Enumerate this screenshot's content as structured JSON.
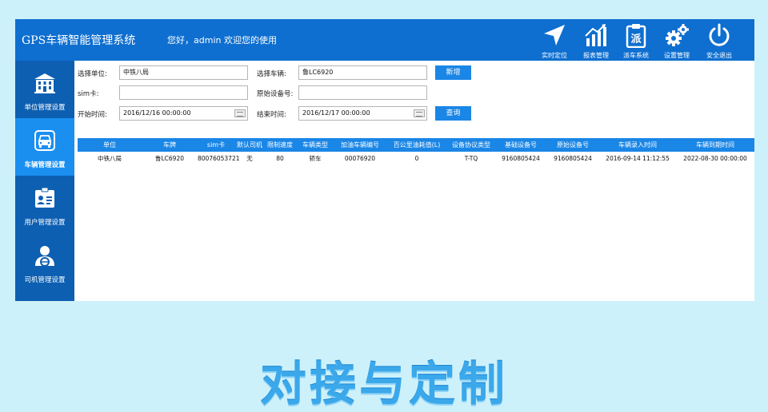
{
  "app": {
    "title": "GPS车辆智能管理系统",
    "welcome": "您好，admin 欢迎您的使用"
  },
  "topnav": [
    {
      "label": "实时定位",
      "icon": "navigation-arrow-icon"
    },
    {
      "label": "报表管理",
      "icon": "bar-chart-icon"
    },
    {
      "label": "派车系统",
      "icon": "dispatch-clipboard-icon",
      "glyph": "派"
    },
    {
      "label": "设置管理",
      "icon": "gears-icon"
    },
    {
      "label": "安全退出",
      "icon": "power-icon"
    }
  ],
  "sidebar": [
    {
      "label": "单位管理设置",
      "icon": "building-icon",
      "active": false
    },
    {
      "label": "车辆管理设置",
      "icon": "car-icon",
      "active": true
    },
    {
      "label": "用户管理设置",
      "icon": "id-card-icon",
      "active": false
    },
    {
      "label": "司机管理设置",
      "icon": "driver-icon",
      "active": false
    }
  ],
  "form": {
    "unit_label": "选择单位:",
    "unit_value": "中铁八局",
    "vehicle_label": "选择车辆:",
    "vehicle_value": "鲁LC6920",
    "sim_label": "sim卡:",
    "sim_value": "",
    "device_label": "原始设备号:",
    "device_value": "",
    "start_label": "开始时间:",
    "start_value": "2016/12/16 00:00:00",
    "end_label": "结束时间:",
    "end_value": "2016/12/17 00:00:00",
    "add_button": "新增",
    "query_button": "查询"
  },
  "table": {
    "columns": [
      "单位",
      "车牌",
      "sim卡",
      "默认司机",
      "限制速度",
      "车辆类型",
      "加油车辆编号",
      "百公里油耗值(L)",
      "设备协议类型",
      "基础设备号",
      "原始设备号",
      "车辆录入时间",
      "车辆到期时间"
    ],
    "rows": [
      [
        "中铁八局",
        "鲁LC6920",
        "80076053721",
        "无",
        "80",
        "轿车",
        "00076920",
        "0",
        "T-TQ",
        "9160805424",
        "9160805424",
        "2016-09-14 11:12:55",
        "2022-08-30 00:00:00"
      ]
    ]
  },
  "banner": "对接与定制",
  "colors": {
    "primary": "#0e6fd0",
    "sidebar": "#0d5fb2",
    "active": "#1a8ff0",
    "background": "#cdf1fa"
  }
}
